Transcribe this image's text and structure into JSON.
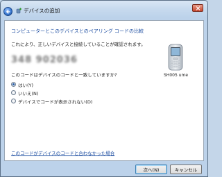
{
  "window": {
    "title": "デバイスの追加"
  },
  "main": {
    "heading": "コンピューターとこのデバイスとのペアリング コードの比較",
    "description": "これにより、正しいデバイスと接続していることが確認されます。",
    "pairing_code": "348 902036",
    "question": "このコードはデバイスのコードと一致していますか?",
    "options": [
      {
        "label": "はい(Y)",
        "selected": true
      },
      {
        "label": "いいえ(N)",
        "selected": false
      },
      {
        "label": "デバイスでコードが表示されない(D)",
        "selected": false
      }
    ],
    "device_name": "SH005 ume",
    "help_link": "このコードがデバイスのコードと合わなかった場合"
  },
  "footer": {
    "next_label": "次へ(N)",
    "cancel_label": "キャンセル"
  },
  "colors": {
    "link": "#1f4fa2",
    "heading": "#1f4fa2"
  }
}
